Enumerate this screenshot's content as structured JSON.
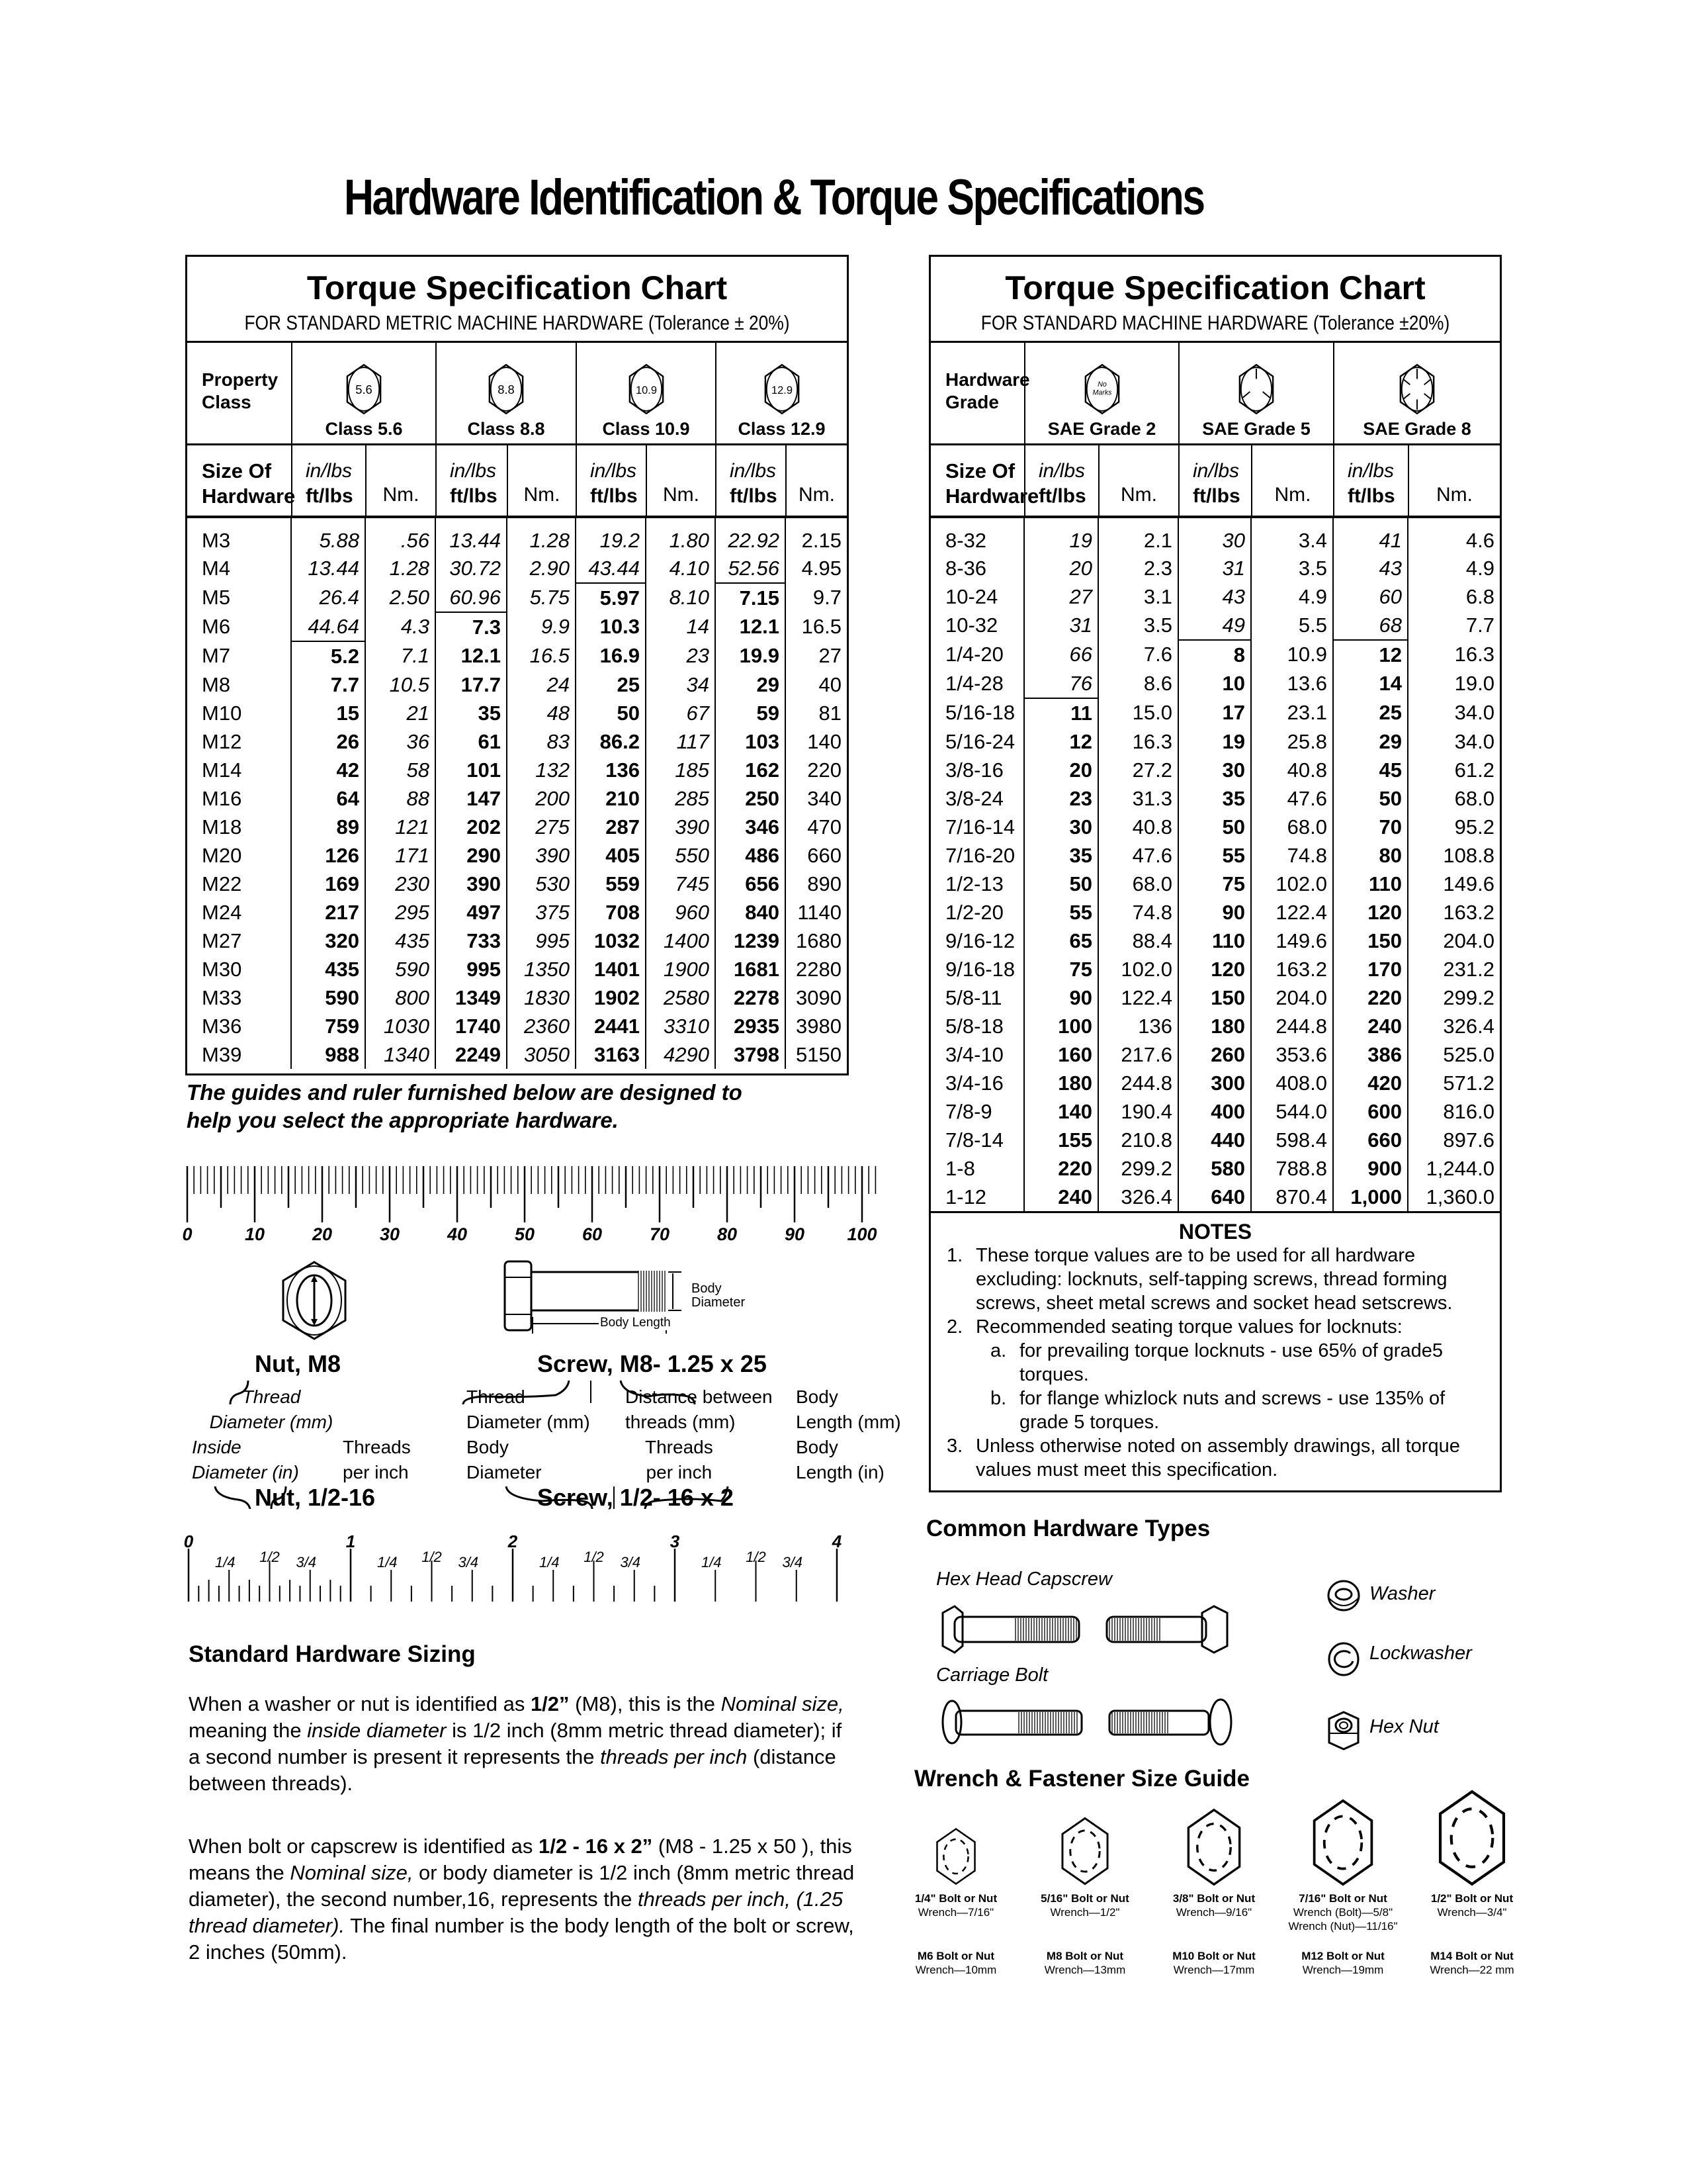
{
  "page_title": "Hardware Identification  &  Torque Specifications",
  "metric_chart": {
    "title": "Torque Specification Chart",
    "subtitle": "FOR STANDARD METRIC MACHINE HARDWARE (Tolerance ± 20%)",
    "class_header": "Property\nClass",
    "classes": [
      {
        "mark": "5.6",
        "label": "Class 5.6"
      },
      {
        "mark": "8.8",
        "label": "Class 8.8"
      },
      {
        "mark": "10.9",
        "label": "Class 10.9"
      },
      {
        "mark": "12.9",
        "label": "Class 12.9"
      }
    ],
    "size_header": "Size Of\nHardware",
    "unit_inlbs": "in/lbs",
    "unit_ftlbs": "ft/lbs",
    "unit_nm": "Nm.",
    "rows": [
      {
        "size": "M3",
        "v": [
          "5.88",
          ".56",
          "13.44",
          "1.28",
          "19.2",
          "1.80",
          "22.92",
          "2.15"
        ]
      },
      {
        "size": "M4",
        "v": [
          "13.44",
          "1.28",
          "30.72",
          "2.90",
          "43.44",
          "4.10",
          "52.56",
          "4.95"
        ]
      },
      {
        "size": "M5",
        "v": [
          "26.4",
          "2.50",
          "60.96",
          "5.75",
          "5.97",
          "8.10",
          "7.15",
          "9.7"
        ]
      },
      {
        "size": "M6",
        "v": [
          "44.64",
          "4.3",
          "7.3",
          "9.9",
          "10.3",
          "14",
          "12.1",
          "16.5"
        ]
      },
      {
        "size": "M7",
        "v": [
          "5.2",
          "7.1",
          "12.1",
          "16.5",
          "16.9",
          "23",
          "19.9",
          "27"
        ]
      },
      {
        "size": "M8",
        "v": [
          "7.7",
          "10.5",
          "17.7",
          "24",
          "25",
          "34",
          "29",
          "40"
        ]
      },
      {
        "size": "M10",
        "v": [
          "15",
          "21",
          "35",
          "48",
          "50",
          "67",
          "59",
          "81"
        ]
      },
      {
        "size": "M12",
        "v": [
          "26",
          "36",
          "61",
          "83",
          "86.2",
          "117",
          "103",
          "140"
        ]
      },
      {
        "size": "M14",
        "v": [
          "42",
          "58",
          "101",
          "132",
          "136",
          "185",
          "162",
          "220"
        ]
      },
      {
        "size": "M16",
        "v": [
          "64",
          "88",
          "147",
          "200",
          "210",
          "285",
          "250",
          "340"
        ]
      },
      {
        "size": "M18",
        "v": [
          "89",
          "121",
          "202",
          "275",
          "287",
          "390",
          "346",
          "470"
        ]
      },
      {
        "size": "M20",
        "v": [
          "126",
          "171",
          "290",
          "390",
          "405",
          "550",
          "486",
          "660"
        ]
      },
      {
        "size": "M22",
        "v": [
          "169",
          "230",
          "390",
          "530",
          "559",
          "745",
          "656",
          "890"
        ]
      },
      {
        "size": "M24",
        "v": [
          "217",
          "295",
          "497",
          "375",
          "708",
          "960",
          "840",
          "1140"
        ]
      },
      {
        "size": "M27",
        "v": [
          "320",
          "435",
          "733",
          "995",
          "1032",
          "1400",
          "1239",
          "1680"
        ]
      },
      {
        "size": "M30",
        "v": [
          "435",
          "590",
          "995",
          "1350",
          "1401",
          "1900",
          "1681",
          "2280"
        ]
      },
      {
        "size": "M33",
        "v": [
          "590",
          "800",
          "1349",
          "1830",
          "1902",
          "2580",
          "2278",
          "3090"
        ]
      },
      {
        "size": "M36",
        "v": [
          "759",
          "1030",
          "1740",
          "2360",
          "2441",
          "3310",
          "2935",
          "3980"
        ]
      },
      {
        "size": "M39",
        "v": [
          "988",
          "1340",
          "2249",
          "3050",
          "3163",
          "4290",
          "3798",
          "5150"
        ]
      }
    ],
    "inlbs_rows_per_class": [
      4,
      3,
      2,
      2
    ]
  },
  "sae_chart": {
    "title": "Torque Specification Chart",
    "subtitle": "FOR STANDARD MACHINE HARDWARE (Tolerance ±20%)",
    "grade_header": "Hardware\nGrade",
    "grades": [
      {
        "mark": "No Marks",
        "label": "SAE Grade 2"
      },
      {
        "mark": "3 radial lines",
        "label": "SAE Grade 5"
      },
      {
        "mark": "6 radial lines",
        "label": "SAE Grade 8"
      }
    ],
    "size_header": "Size Of\nHardware",
    "unit_inlbs": "in/lbs",
    "unit_ftlbs": "ft/lbs",
    "unit_nm": "Nm.",
    "rows": [
      {
        "size": "8-32",
        "v": [
          "19",
          "2.1",
          "30",
          "3.4",
          "41",
          "4.6"
        ]
      },
      {
        "size": "8-36",
        "v": [
          "20",
          "2.3",
          "31",
          "3.5",
          "43",
          "4.9"
        ]
      },
      {
        "size": "10-24",
        "v": [
          "27",
          "3.1",
          "43",
          "4.9",
          "60",
          "6.8"
        ]
      },
      {
        "size": "10-32",
        "v": [
          "31",
          "3.5",
          "49",
          "5.5",
          "68",
          "7.7"
        ]
      },
      {
        "size": "1/4-20",
        "v": [
          "66",
          "7.6",
          "8",
          "10.9",
          "12",
          "16.3"
        ]
      },
      {
        "size": "1/4-28",
        "v": [
          "76",
          "8.6",
          "10",
          "13.6",
          "14",
          "19.0"
        ]
      },
      {
        "size": "5/16-18",
        "v": [
          "11",
          "15.0",
          "17",
          "23.1",
          "25",
          "34.0"
        ]
      },
      {
        "size": "5/16-24",
        "v": [
          "12",
          "16.3",
          "19",
          "25.8",
          "29",
          "34.0"
        ]
      },
      {
        "size": "3/8-16",
        "v": [
          "20",
          "27.2",
          "30",
          "40.8",
          "45",
          "61.2"
        ]
      },
      {
        "size": "3/8-24",
        "v": [
          "23",
          "31.3",
          "35",
          "47.6",
          "50",
          "68.0"
        ]
      },
      {
        "size": "7/16-14",
        "v": [
          "30",
          "40.8",
          "50",
          "68.0",
          "70",
          "95.2"
        ]
      },
      {
        "size": "7/16-20",
        "v": [
          "35",
          "47.6",
          "55",
          "74.8",
          "80",
          "108.8"
        ]
      },
      {
        "size": "1/2-13",
        "v": [
          "50",
          "68.0",
          "75",
          "102.0",
          "110",
          "149.6"
        ]
      },
      {
        "size": "1/2-20",
        "v": [
          "55",
          "74.8",
          "90",
          "122.4",
          "120",
          "163.2"
        ]
      },
      {
        "size": "9/16-12",
        "v": [
          "65",
          "88.4",
          "110",
          "149.6",
          "150",
          "204.0"
        ]
      },
      {
        "size": "9/16-18",
        "v": [
          "75",
          "102.0",
          "120",
          "163.2",
          "170",
          "231.2"
        ]
      },
      {
        "size": "5/8-11",
        "v": [
          "90",
          "122.4",
          "150",
          "204.0",
          "220",
          "299.2"
        ]
      },
      {
        "size": "5/8-18",
        "v": [
          "100",
          "136",
          "180",
          "244.8",
          "240",
          "326.4"
        ]
      },
      {
        "size": "3/4-10",
        "v": [
          "160",
          "217.6",
          "260",
          "353.6",
          "386",
          "525.0"
        ]
      },
      {
        "size": "3/4-16",
        "v": [
          "180",
          "244.8",
          "300",
          "408.0",
          "420",
          "571.2"
        ]
      },
      {
        "size": "7/8-9",
        "v": [
          "140",
          "190.4",
          "400",
          "544.0",
          "600",
          "816.0"
        ]
      },
      {
        "size": "7/8-14",
        "v": [
          "155",
          "210.8",
          "440",
          "598.4",
          "660",
          "897.6"
        ]
      },
      {
        "size": "1-8",
        "v": [
          "220",
          "299.2",
          "580",
          "788.8",
          "900",
          "1,244.0"
        ]
      },
      {
        "size": "1-12",
        "v": [
          "240",
          "326.4",
          "640",
          "870.4",
          "1,000",
          "1,360.0"
        ]
      }
    ],
    "inlbs_rows_per_grade": [
      6,
      4,
      4
    ],
    "notes_title": "NOTES",
    "notes": [
      {
        "n": "1.",
        "text": "These torque values are to be used for all hardware excluding: locknuts, self-tapping screws, thread forming screws, sheet metal screws and socket head setscrews."
      },
      {
        "n": "2.",
        "text": "Recommended seating torque values for locknuts:"
      },
      {
        "n": "a.",
        "text": "for prevailing torque locknuts - use 65% of grade5 torques.",
        "sub": true
      },
      {
        "n": "b.",
        "text": "for flange whizlock nuts and screws - use 135% of grade 5 torques.",
        "sub": true
      },
      {
        "n": "3.",
        "text": "Unless otherwise noted on assembly drawings, all torque values must meet this specification."
      }
    ]
  },
  "guide_text": [
    "The guides and ruler furnished below are designed to",
    "help you select the appropriate hardware."
  ],
  "mm_ruler": {
    "labels": [
      "0",
      "10",
      "20",
      "30",
      "40",
      "50",
      "60",
      "70",
      "80",
      "90",
      "100"
    ]
  },
  "inch_ruler": {
    "majors": [
      "0",
      "1",
      "2",
      "3",
      "4"
    ],
    "minors": [
      "1/4",
      "1/2",
      "3/4"
    ]
  },
  "diagram": {
    "nut_m8": "Nut, M8",
    "screw_m8": "Screw, M8- 1.25 x 25",
    "body_diameter": "Body\nDiameter",
    "body_length": "Body Length",
    "nut_thread_diam": [
      "Thread",
      "Diameter (mm)"
    ],
    "screw_thread_diam": [
      "Thread",
      "Diameter (mm)"
    ],
    "distance_between": [
      "Distance between",
      "threads (mm)"
    ],
    "body_length_mm": [
      "Body",
      "Length (mm)"
    ],
    "inside_diam": [
      "Inside",
      "Diameter (in)"
    ],
    "threads_per_inch_nut": [
      "Threads",
      "per inch"
    ],
    "body_diam2": [
      "Body",
      "Diameter"
    ],
    "threads_per_inch_screw": [
      "Threads",
      "per inch"
    ],
    "body_length_in": [
      "Body",
      "Length (in)"
    ],
    "nut_half": "Nut, 1/2-16",
    "screw_half": "Screw, 1/2- 16 x 2"
  },
  "sizing": {
    "title": "Standard Hardware Sizing",
    "p1": [
      {
        "t": "When a washer or nut is identified as "
      },
      {
        "t": "1/2”",
        "b": true
      },
      {
        "t": " (M8), this is the "
      },
      {
        "t": "Nominal size,",
        "i": true
      },
      {
        "t": " meaning the "
      },
      {
        "t": "inside diameter",
        "i": true
      },
      {
        "t": " is 1/2 inch (8mm metric thread diameter); if a second number is present it represents the "
      },
      {
        "t": "threads per inch",
        "i": true
      },
      {
        "t": " (distance between threads)."
      }
    ],
    "p2": [
      {
        "t": "When bolt or capscrew is identified as "
      },
      {
        "t": "1/2 - 16 x 2”",
        "b": true
      },
      {
        "t": " (M8 - 1.25 x 50 ), this means the "
      },
      {
        "t": "Nominal size,",
        "i": true
      },
      {
        "t": " or body diameter is 1/2 inch (8mm metric thread diameter), the second number,16, represents the "
      },
      {
        "t": "threads per inch, (1.25 thread diameter).",
        "i": true
      },
      {
        "t": " The final number is the body length of the bolt or screw, 2 inches (50mm)."
      }
    ]
  },
  "common_types": {
    "title": "Common Hardware Types",
    "hex_capscrew": "Hex Head Capscrew",
    "carriage_bolt": "Carriage Bolt",
    "washer": "Washer",
    "lockwasher": "Lockwasher",
    "hex_nut": "Hex Nut"
  },
  "wrench_guide": {
    "title": "Wrench & Fastener Size Guide",
    "items": [
      {
        "sae": "1/4\" Bolt or Nut",
        "sae_wrench": [
          "Wrench—7/16\""
        ],
        "metric": "M6 Bolt or Nut",
        "metric_wrench": "Wrench—10mm"
      },
      {
        "sae": "5/16\" Bolt or Nut",
        "sae_wrench": [
          "Wrench—1/2\""
        ],
        "metric": "M8 Bolt or Nut",
        "metric_wrench": "Wrench—13mm"
      },
      {
        "sae": "3/8\" Bolt or Nut",
        "sae_wrench": [
          "Wrench—9/16\""
        ],
        "metric": "M10 Bolt or Nut",
        "metric_wrench": "Wrench—17mm"
      },
      {
        "sae": "7/16\" Bolt or Nut",
        "sae_wrench": [
          "Wrench (Bolt)—5/8\"",
          "Wrench (Nut)—11/16\""
        ],
        "metric": "M12 Bolt or Nut",
        "metric_wrench": "Wrench—19mm"
      },
      {
        "sae": "1/2\" Bolt or Nut",
        "sae_wrench": [
          "Wrench—3/4\""
        ],
        "metric": "M14 Bolt or Nut",
        "metric_wrench": "Wrench—22 mm"
      }
    ]
  }
}
